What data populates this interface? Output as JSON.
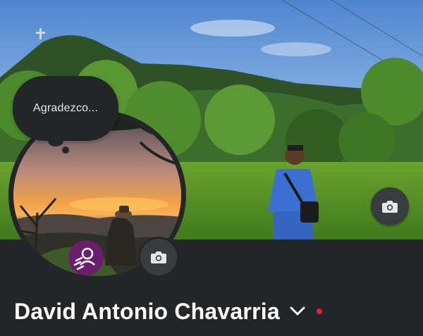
{
  "profile": {
    "name": "David Antonio Chavarria",
    "note": "Agradezco...",
    "name_menu_icon": "chevron-down-icon",
    "notification_dot_color": "#e41e3f"
  },
  "cover_photo": {
    "camera_icon": "camera-icon"
  },
  "avatar": {
    "camera_icon": "camera-icon",
    "badge_icon": "avatar-badge-icon",
    "badge_color": "#6b1f6b"
  },
  "colors": {
    "panel_background": "#242526",
    "button_background": "#3a3b3c",
    "text_primary": "#ffffff"
  }
}
